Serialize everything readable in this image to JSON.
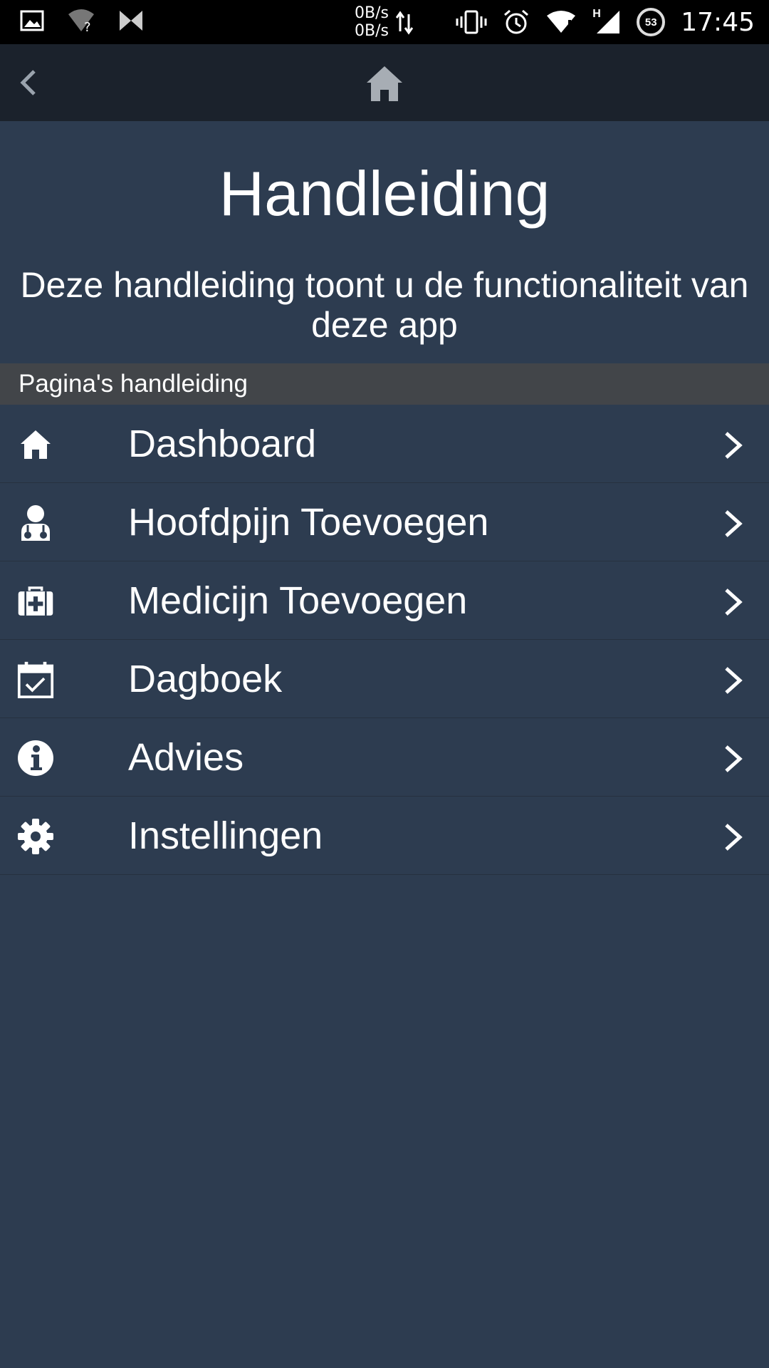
{
  "status_bar": {
    "net_up": "0B/s",
    "net_down": "0B/s",
    "network_type": "H",
    "battery": "53",
    "time": "17:45",
    "icons": [
      "image-icon",
      "wifi-unknown-icon",
      "app-notification-icon",
      "data-transfer-icon",
      "vibrate-icon",
      "alarm-icon",
      "wifi-alert-icon",
      "cell-signal-icon",
      "battery-icon"
    ]
  },
  "app_bar": {
    "back_icon": "chevron-left-icon",
    "home_icon": "home-icon"
  },
  "header": {
    "title": "Handleiding",
    "subtitle": "Deze handleiding toont u de functionaliteit van deze app"
  },
  "section": {
    "title": "Pagina's handleiding"
  },
  "menu": {
    "items": [
      {
        "label": "Dashboard",
        "icon": "home-icon"
      },
      {
        "label": "Hoofdpijn Toevoegen",
        "icon": "user-doctor-icon"
      },
      {
        "label": "Medicijn Toevoegen",
        "icon": "medkit-icon"
      },
      {
        "label": "Dagboek",
        "icon": "calendar-check-icon"
      },
      {
        "label": "Advies",
        "icon": "info-icon"
      },
      {
        "label": "Instellingen",
        "icon": "gear-icon"
      }
    ]
  },
  "colors": {
    "background": "#2d3c50",
    "app_bar": "#1b222c",
    "section_header": "#424549",
    "status_bar": "#000000",
    "text": "#ffffff"
  }
}
